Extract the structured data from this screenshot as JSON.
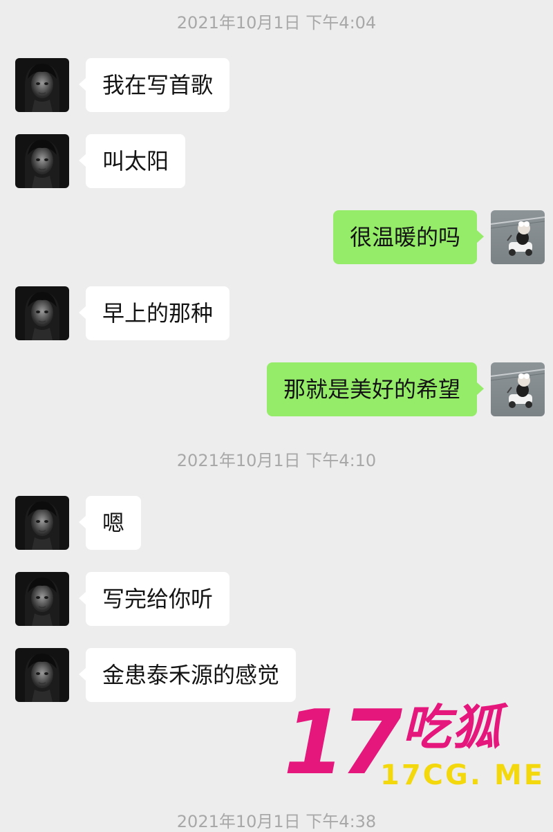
{
  "colors": {
    "background": "#ededed",
    "incoming_bubble": "#ffffff",
    "outgoing_bubble": "#95ec69",
    "timestamp_text": "#a8a8a8",
    "watermark_pink": "#e5177d",
    "watermark_yellow": "#f3d80e"
  },
  "chat": {
    "timestamps": [
      "2021年10月1日 下午4:04",
      "2021年10月1日 下午4:10",
      "2021年10月1日 下午4:38"
    ],
    "messages": [
      {
        "sender": "contact",
        "text": "我在写首歌"
      },
      {
        "sender": "contact",
        "text": "叫太阳"
      },
      {
        "sender": "me",
        "text": "很温暖的吗"
      },
      {
        "sender": "contact",
        "text": "早上的那种"
      },
      {
        "sender": "me",
        "text": "那就是美好的希望"
      },
      {
        "sender": "contact",
        "text": "嗯"
      },
      {
        "sender": "contact",
        "text": "写完给你听"
      },
      {
        "sender": "contact",
        "text": "金患泰禾源的感觉"
      }
    ],
    "avatars": {
      "contact": "dark-portrait-avatar",
      "me": "scooter-photo-avatar"
    }
  },
  "watermark": {
    "number": "17",
    "name": "吃狐",
    "domain": "17CG. ME"
  }
}
